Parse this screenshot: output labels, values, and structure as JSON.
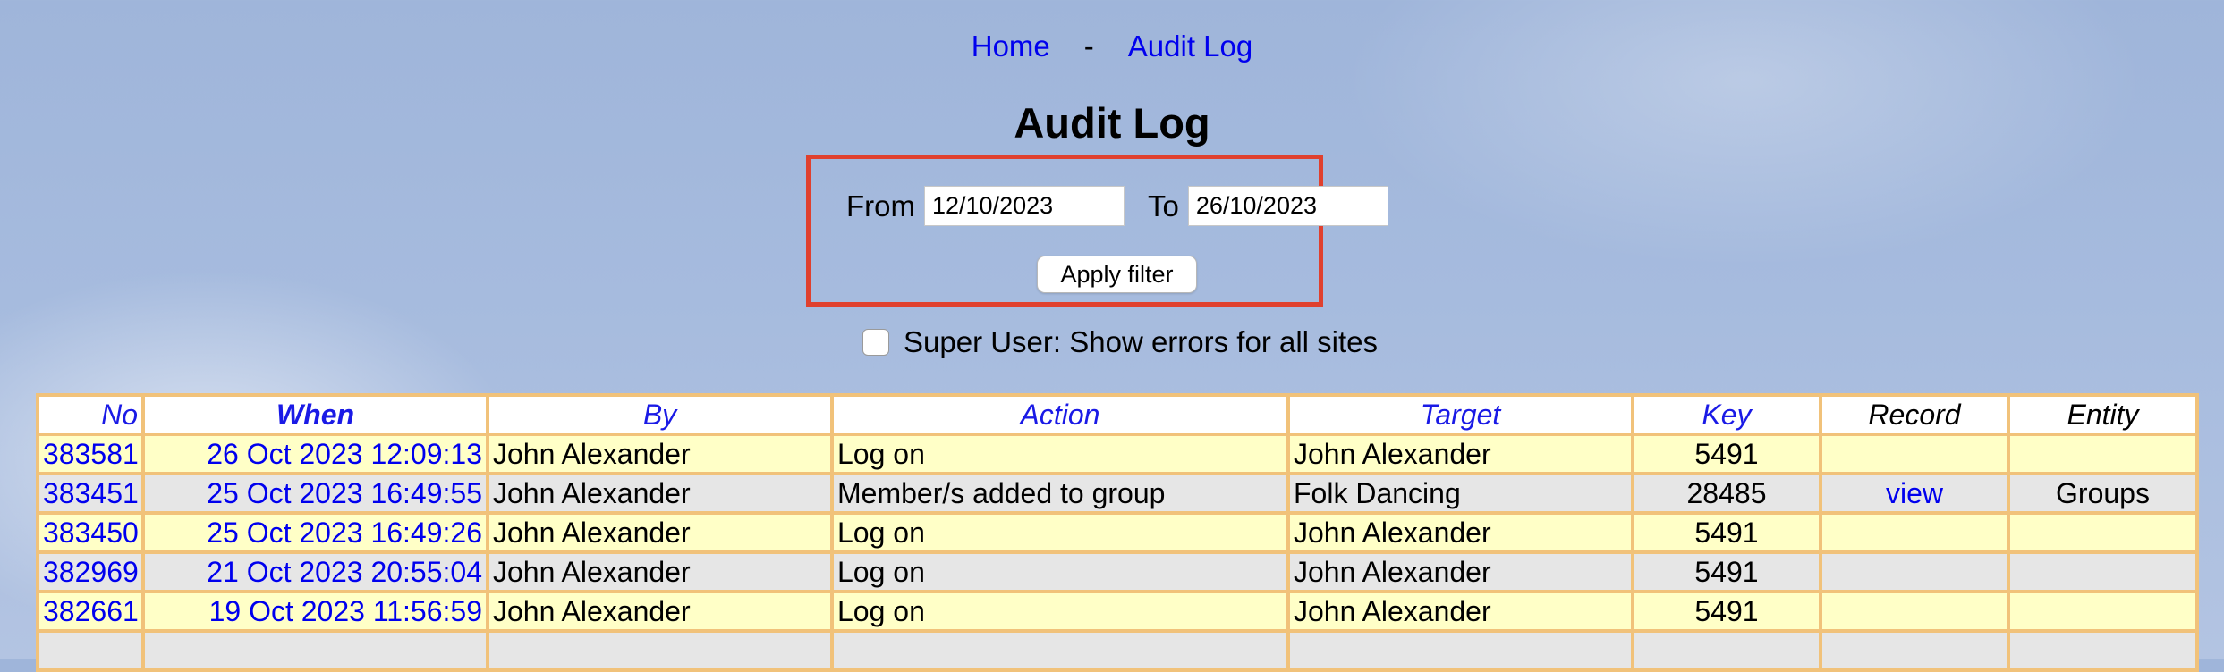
{
  "breadcrumb": {
    "home": "Home",
    "separator": "-",
    "current": "Audit Log"
  },
  "page_title": "Audit Log",
  "filter": {
    "from_label": "From",
    "from_value": "12/10/2023",
    "to_label": "To",
    "to_value": "26/10/2023",
    "apply_label": "Apply filter"
  },
  "super_user": {
    "label": "Super User: Show errors for all sites",
    "checked": false
  },
  "table": {
    "headers": {
      "no": "No",
      "when": "When",
      "by": "By",
      "action": "Action",
      "target": "Target",
      "key": "Key",
      "record": "Record",
      "entity": "Entity"
    },
    "rows": [
      {
        "no": "383581",
        "when": "26 Oct 2023 12:09:13",
        "by": "John Alexander",
        "action": "Log on",
        "target": "John Alexander",
        "key": "5491",
        "record": "",
        "entity": ""
      },
      {
        "no": "383451",
        "when": "25 Oct 2023 16:49:55",
        "by": "John Alexander",
        "action": "Member/s added to group",
        "target": "Folk Dancing",
        "key": "28485",
        "record": "view",
        "entity": "Groups"
      },
      {
        "no": "383450",
        "when": "25 Oct 2023 16:49:26",
        "by": "John Alexander",
        "action": "Log on",
        "target": "John Alexander",
        "key": "5491",
        "record": "",
        "entity": ""
      },
      {
        "no": "382969",
        "when": "21 Oct 2023 20:55:04",
        "by": "John Alexander",
        "action": "Log on",
        "target": "John Alexander",
        "key": "5491",
        "record": "",
        "entity": ""
      },
      {
        "no": "382661",
        "when": "19 Oct 2023 11:56:59",
        "by": "John Alexander",
        "action": "Log on",
        "target": "John Alexander",
        "key": "5491",
        "record": "",
        "entity": ""
      }
    ]
  },
  "colors": {
    "link": "#0000ee",
    "filter_border": "#e0402e",
    "table_border": "#f1c27a",
    "row_odd": "#ffffc7",
    "row_even": "#e6e6e6"
  }
}
